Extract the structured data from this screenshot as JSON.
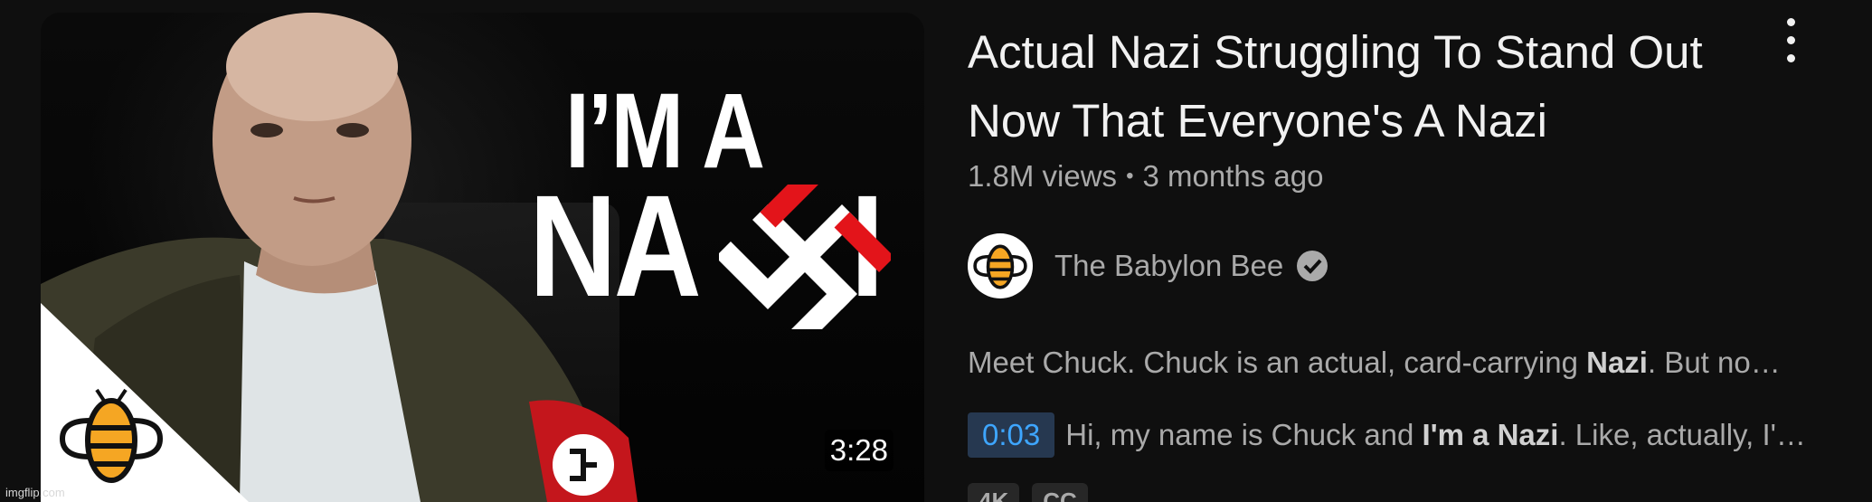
{
  "video": {
    "thumbnail": {
      "title_line1": "I’M A",
      "title_line2_left": "NA",
      "title_line2_right": "I",
      "duration": "3:28",
      "accent_red": "#e3141a",
      "logo_color": "#f5a623"
    },
    "title": "Actual Nazi Struggling To Stand Out Now That Everyone's A Nazi",
    "views": "1.8M views",
    "age": "3 months ago",
    "channel": {
      "name": "The Babylon Bee",
      "verified": true,
      "avatar_icon": "bee-logo-icon"
    },
    "description": {
      "pre": "Meet Chuck. Chuck is an actual, card-carrying ",
      "bold": "Nazi",
      "post": ". But no…"
    },
    "chapter": {
      "timestamp": "0:03",
      "pre": "Hi, my name is Chuck and ",
      "bold": "I'm a Nazi",
      "post": ". Like, actually, I'…"
    },
    "badges": [
      "4K",
      "CC"
    ]
  },
  "watermark": "imgflip.com"
}
